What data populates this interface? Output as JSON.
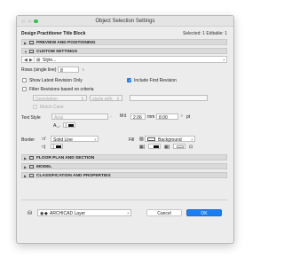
{
  "window": {
    "title": "Object Selection Settings"
  },
  "header": {
    "name": "Design Practitioner Title Block",
    "status": "Selected: 1 Editable: 1"
  },
  "sections": {
    "preview": "PREVIEW AND POSITIONING",
    "custom": "CUSTOM SETTINGS",
    "floorplan": "FLOOR PLAN AND SECTION",
    "model": "MODEL",
    "classification": "CLASSIFICATION AND PROPERTIES"
  },
  "custom": {
    "style_label": "Style...",
    "rows_label": "Rows (single line)",
    "rows_value": "8",
    "show_latest": "Show Latest Revision Only",
    "include_first": "Include First Revision",
    "filter": "Filter Revisions based on criteria",
    "description_placeholder": "Description",
    "starts_with_placeholder": "starts with",
    "match_case": "Match Case",
    "text_style_label": "Text Style",
    "font_value": "Arial",
    "font_size": "2.06",
    "unit_mm": "mm",
    "line_spacing": "8.00",
    "unit_pt": "pt",
    "border_label": "Border",
    "border_line": "Solid Line",
    "fill_label": "Fill",
    "fill_value": "Background"
  },
  "footer": {
    "layer": "ARCHICAD Layer",
    "cancel": "Cancel",
    "ok": "OK"
  },
  "colors": {
    "accent": "#1b7ff4",
    "max_button": "#2fc44a"
  }
}
